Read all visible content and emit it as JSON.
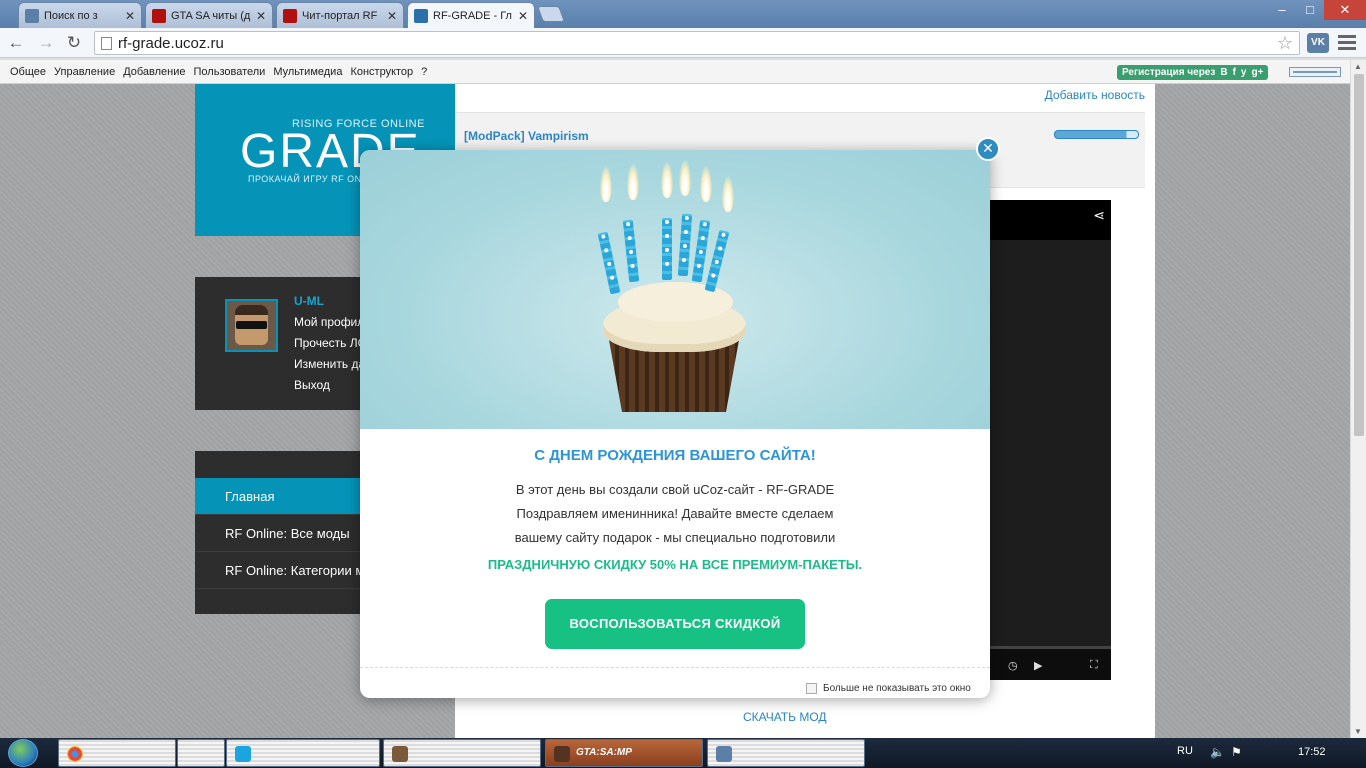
{
  "browser": {
    "tabs": [
      {
        "title": "Поиск по з",
        "icon_color": "#5b7fa6"
      },
      {
        "title": "GTA SA читы (д",
        "icon_color": "#b01010"
      },
      {
        "title": "Чит-портал RF",
        "icon_color": "#b01010"
      },
      {
        "title": "RF-GRADE - Гл",
        "icon_color": "#2d6fa8"
      }
    ],
    "url": "rf-grade.ucoz.ru",
    "vk_label": "VK"
  },
  "adminbar": {
    "menu": [
      "Общее",
      "Управление",
      "Добавление",
      "Пользователи",
      "Мультимедиа",
      "Конструктор",
      "?"
    ],
    "register_label": "Регистрация через",
    "social": [
      "B",
      "f",
      "y",
      "g+"
    ]
  },
  "site": {
    "logo": {
      "subtitle_top": "RISING FORCE ONLINE",
      "name": "GRADE",
      "subtitle_bottom": "ПРОКАЧАЙ ИГРУ RF ONLINE"
    },
    "user": {
      "name": "U-ML",
      "links": [
        "Мой профиль",
        "Прочесть ЛС",
        "Изменить данные",
        "Выход"
      ]
    },
    "menu": {
      "items": [
        "Главная",
        "RF Online: Все моды",
        "RF Online: Категории модов"
      ]
    },
    "add_news": "Добавить новость",
    "post_title": "[ModPack] Vampirism",
    "download": "СКАЧАТЬ МОД",
    "rating_fraction": 0.86
  },
  "modal": {
    "title": "С ДНЕМ РОЖДЕНИЯ ВАШЕГО САЙТА!",
    "lines": [
      "В этот день вы создали свой uCoz-сайт - RF-GRADE",
      "Поздравляем именинника! Давайте вместе сделаем",
      "вашему сайту подарок - мы специально подготовили"
    ],
    "promo": "ПРАЗДНИЧНУЮ СКИДКУ 50% НА ВСЕ ПРЕМИУМ-ПАКЕТЫ.",
    "button": "ВОСПОЛЬЗОВАТЬСЯ СКИДКОЙ",
    "checkbox_label": "Больше не показывать это окно",
    "close_icon": "close-icon",
    "accent_color": "#2d95d6",
    "button_color": "#17c083"
  },
  "taskbar": {
    "active_app": "GTA:SA:MP",
    "language": "RU",
    "time": "17:52"
  }
}
